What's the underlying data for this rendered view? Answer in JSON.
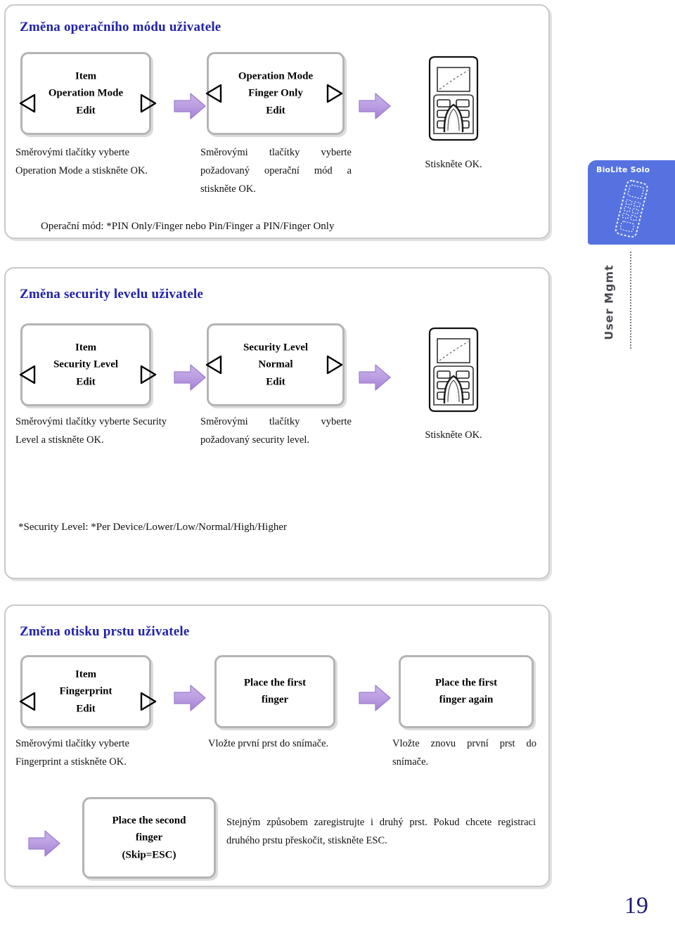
{
  "page": {
    "number": "19"
  },
  "side_tab": {
    "title": "BioLite Solo",
    "vertical_label": "User Mgmt",
    "color": "#5572e0",
    "device_icon": "biolite-device-icon"
  },
  "sections": [
    {
      "title": "Změna operačního módu uživatele",
      "steps": [
        {
          "lcd": {
            "l1": "Item",
            "l2": "Operation Mode",
            "l3": "Edit",
            "left_icon": "triangle-left-icon",
            "right_icon": "triangle-right-icon"
          },
          "caption": "Směrovými tlačítky vyberte Operation Mode a stiskněte OK."
        },
        {
          "lcd": {
            "l1": "Operation Mode",
            "l2": "Finger Only",
            "l3": "Edit",
            "left_icon": "triangle-left-icon",
            "right_icon": "triangle-right-icon"
          },
          "caption": "Směrovými tlačítky vyberte požadovaný operační mód a stiskněte OK."
        },
        {
          "device_icon": "keypad-device-icon",
          "caption": "Stiskněte OK."
        }
      ],
      "footnote": "Operační mód: *PIN Only/Finger nebo Pin/Finger a  PIN/Finger Only"
    },
    {
      "title": "Změna security levelu uživatele",
      "steps": [
        {
          "lcd": {
            "l1": "Item",
            "l2": "Security Level",
            "l3": "Edit",
            "left_icon": "triangle-left-icon",
            "right_icon": "triangle-right-icon"
          },
          "caption": "Směrovými tlačítky vyberte Security Level a stiskněte OK."
        },
        {
          "lcd": {
            "l1": "Security Level",
            "l2": "Normal",
            "l3": "Edit",
            "left_icon": "triangle-left-icon",
            "right_icon": "triangle-right-icon"
          },
          "caption": "Směrovými tlačítky vyberte požadovaný security level."
        },
        {
          "device_icon": "keypad-device-icon",
          "caption": "Stiskněte OK."
        }
      ],
      "footnote": "*Security Level: *Per Device/Lower/Low/Normal/High/Higher"
    },
    {
      "title": "Změna otisku prstu uživatele",
      "steps": [
        {
          "lcd": {
            "l1": "Item",
            "l2": "Fingerprint",
            "l3": "Edit",
            "left_icon": "triangle-left-icon",
            "right_icon": "triangle-right-icon"
          },
          "caption": "Směrovými tlačítky vyberte Fingerprint a stiskněte OK."
        },
        {
          "lcd": {
            "l1": "Place the first",
            "l2": "finger",
            "l3": ""
          },
          "caption": "Vložte první prst do snímače."
        },
        {
          "lcd": {
            "l1": "Place the first",
            "l2": "finger again",
            "l3": ""
          },
          "caption": "Vložte znovu první prst do snímače."
        },
        {
          "lcd": {
            "l1": "Place the second",
            "l2": "finger",
            "l3": "(Skip=ESC)"
          },
          "caption": "Stejným způsobem zaregistrujte i druhý prst. Pokud chcete registraci druhého prstu přeskočit, stiskněte ESC."
        }
      ]
    }
  ],
  "arrow": {
    "icon": "block-arrow-right-icon",
    "color": "#b99ce0"
  }
}
